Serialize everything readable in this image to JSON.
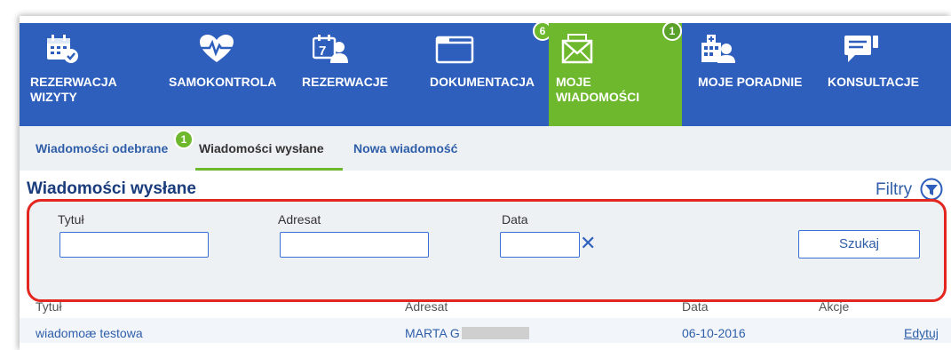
{
  "nav": {
    "items": [
      {
        "label1": "REZERWACJA",
        "label2": "WIZYTY",
        "icon": "calendar-check-icon"
      },
      {
        "label1": "SAMOKONTROLA",
        "label2": "",
        "icon": "heart-pulse-icon"
      },
      {
        "label1": "REZERWACJE",
        "label2": "",
        "icon": "calendar-person-icon"
      },
      {
        "label1": "DOKUMENTACJA",
        "label2": "",
        "icon": "folder-icon",
        "badge": "6"
      },
      {
        "label1": "MOJE",
        "label2": "WIADOMOŚCI",
        "icon": "envelope-icon",
        "badge": "1"
      },
      {
        "label1": "MOJE PORADNIE",
        "label2": "",
        "icon": "hospital-icon"
      },
      {
        "label1": "KONSULTACJE",
        "label2": "",
        "icon": "chat-icon"
      }
    ],
    "colors": {
      "bar": "#2f5fbd",
      "active": "#6eb82d"
    }
  },
  "subnav": {
    "received": "Wiadomości odebrane",
    "received_badge": "1",
    "sent": "Wiadomości wysłane",
    "new": "Nowa wiadomość"
  },
  "page": {
    "title": "Wiadomości wysłane",
    "filters_label": "Filtry"
  },
  "filters": {
    "title_label": "Tytuł",
    "title_value": "",
    "recipient_label": "Adresat",
    "recipient_value": "",
    "date_label": "Data",
    "date_value": "",
    "clear_symbol": "✕",
    "search_button": "Szukaj"
  },
  "table": {
    "headers": [
      "Tytuł",
      "Adresat",
      "Data",
      "Akcje"
    ],
    "rows": [
      {
        "title": "wiadomoæ testowa",
        "recipient": "MARTA G",
        "date": "06-10-2016",
        "action": "Edytuj"
      }
    ]
  }
}
